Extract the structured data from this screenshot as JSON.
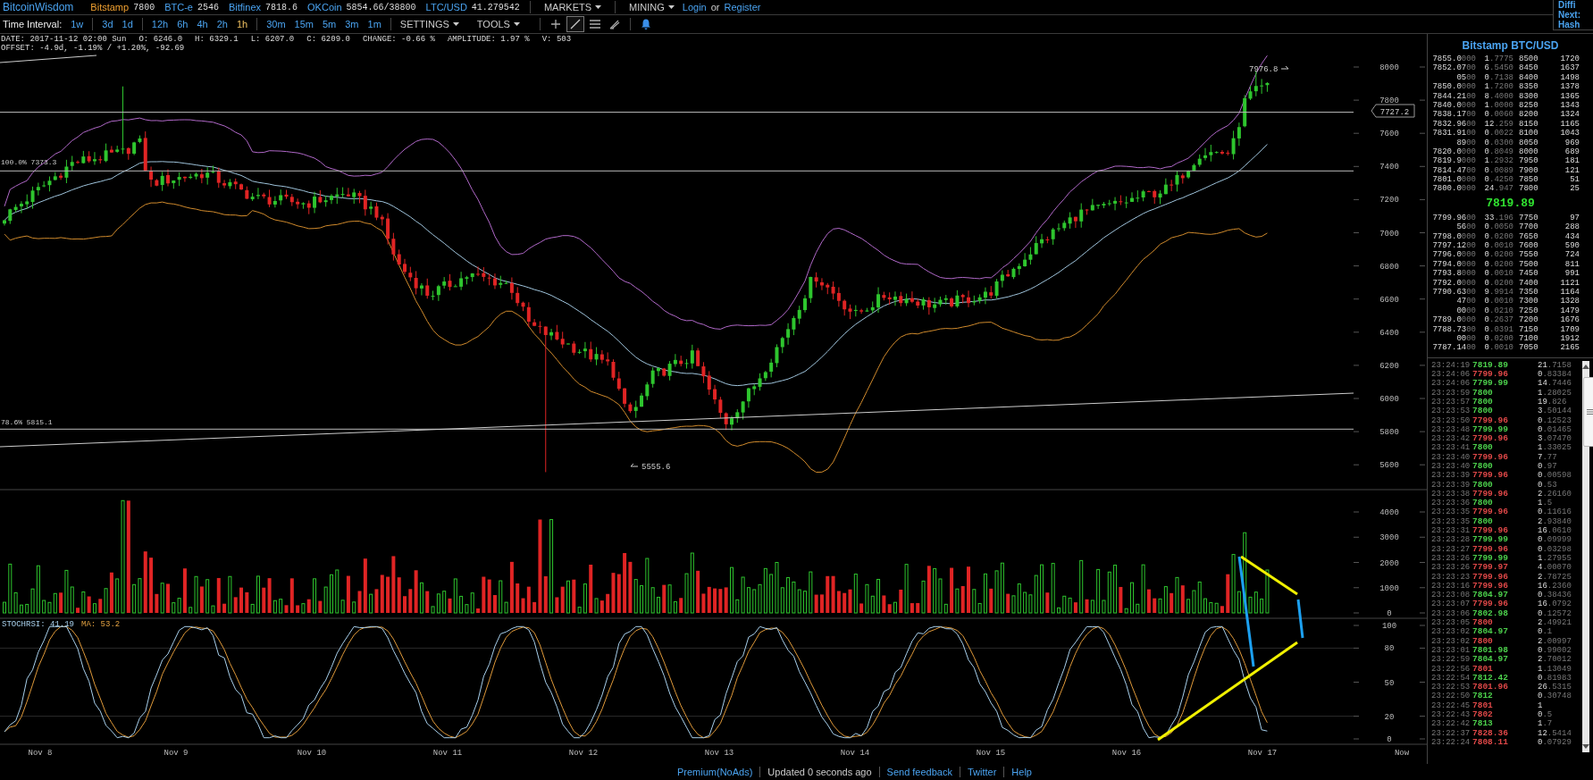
{
  "header": {
    "logo": "BitcoinWisdom",
    "tickers": [
      {
        "exchange": "Bitstamp",
        "price": "7800",
        "selected": true
      },
      {
        "exchange": "BTC-e",
        "price": "2546",
        "selected": false
      },
      {
        "exchange": "Bitfinex",
        "price": "7818.6",
        "selected": false
      },
      {
        "exchange": "OKCoin",
        "price": "5854.66/38800",
        "selected": false
      },
      {
        "exchange": "LTC/USD",
        "price": "41.279542",
        "selected": false
      }
    ],
    "menus": [
      "MARKETS",
      "MINING"
    ],
    "login": "Login",
    "or": "or",
    "register": "Register"
  },
  "mining_box": [
    "Diffi",
    "Next:",
    "Hash"
  ],
  "toolbar": {
    "label": "Time Interval:",
    "interval_groups": [
      [
        {
          "label": "1w",
          "selected": false
        }
      ],
      [
        {
          "label": "3d",
          "selected": false
        },
        {
          "label": "1d",
          "selected": false
        }
      ],
      [
        {
          "label": "12h",
          "selected": false
        },
        {
          "label": "6h",
          "selected": false
        },
        {
          "label": "4h",
          "selected": false
        },
        {
          "label": "2h",
          "selected": false
        },
        {
          "label": "1h",
          "selected": true
        }
      ],
      [
        {
          "label": "30m",
          "selected": false
        },
        {
          "label": "15m",
          "selected": false
        },
        {
          "label": "5m",
          "selected": false
        },
        {
          "label": "3m",
          "selected": false
        },
        {
          "label": "1m",
          "selected": false
        }
      ]
    ],
    "menus": [
      "SETTINGS",
      "TOOLS"
    ],
    "tools": [
      {
        "kind": "plus",
        "selected": false
      },
      {
        "kind": "line",
        "selected": true
      },
      {
        "kind": "lines",
        "selected": false
      },
      {
        "kind": "pen",
        "selected": false
      },
      {
        "kind": "bell",
        "selected": false
      }
    ]
  },
  "info": {
    "line_1": [
      "DATE: 2017-11-12 02:00 Sun",
      "O: 6246.0",
      "H: 6329.1",
      "L: 6207.0",
      "C: 6209.0",
      "CHANGE: -0.66 %",
      "AMPLITUDE: 1.97 %",
      "V: 503"
    ],
    "line_2": "OFFSET: -4.9d, -1.19% / +1.20%, -92.69"
  },
  "chart": {
    "price_ticks": [
      "8000",
      "7800",
      "7600",
      "7400",
      "7200",
      "7000",
      "6800",
      "6600",
      "6400",
      "6200",
      "6000",
      "5800",
      "5600"
    ],
    "current_price_tag": "7727.2",
    "high_label": "7976.8",
    "low_label": "5555.6",
    "fib_labels": [
      "100.0% 7373.3",
      "78.6% 5815.1"
    ],
    "volume_ticks": [
      "4000",
      "3000",
      "2000",
      "1000",
      "0"
    ],
    "stoch_label": "STOCHRSI: 41.19",
    "stoch_ma_label": "MA: 53.2",
    "stoch_ticks": [
      "100",
      "80",
      "50",
      "20",
      "0"
    ],
    "dates": [
      "Nov 8",
      "Nov 9",
      "Nov 10",
      "Nov 11",
      "Nov 12",
      "Nov 13",
      "Nov 14",
      "Nov 15",
      "Nov 16",
      "Nov 17"
    ],
    "now": "Now"
  },
  "order_book": {
    "title": "Bitstamp BTC/USD",
    "asks": [
      {
        "price": "7855.0",
        "price_tail": "000",
        "amount": "1.7775",
        "level": "8500",
        "total": "1720"
      },
      {
        "price": "7852.07",
        "price_tail": "00",
        "amount": "6.5450",
        "level": "8450",
        "total": "1637"
      },
      {
        "price": "05",
        "price_tail": "00",
        "amount": "0.7138",
        "level": "8400",
        "total": "1498"
      },
      {
        "price": "7850.0",
        "price_tail": "000",
        "amount": "1.7200",
        "level": "8350",
        "total": "1378"
      },
      {
        "price": "7844.21",
        "price_tail": "00",
        "amount": "8.4000",
        "level": "8300",
        "total": "1365"
      },
      {
        "price": "7840.0",
        "price_tail": "000",
        "amount": "1.0000",
        "level": "8250",
        "total": "1343"
      },
      {
        "price": "7838.17",
        "price_tail": "00",
        "amount": "0.0060",
        "level": "8200",
        "total": "1324"
      },
      {
        "price": "7832.96",
        "price_tail": "00",
        "amount": "12.259",
        "level": "8150",
        "total": "1165"
      },
      {
        "price": "7831.91",
        "price_tail": "00",
        "amount": "0.0022",
        "level": "8100",
        "total": "1043"
      },
      {
        "price": "89",
        "price_tail": "00",
        "amount": "0.0300",
        "level": "8050",
        "total": "969"
      },
      {
        "price": "7820.0",
        "price_tail": "000",
        "amount": "0.8049",
        "level": "8000",
        "total": "689"
      },
      {
        "price": "7819.9",
        "price_tail": "000",
        "amount": "1.2932",
        "level": "7950",
        "total": "181"
      },
      {
        "price": "7814.47",
        "price_tail": "00",
        "amount": "0.0089",
        "level": "7900",
        "total": "121"
      },
      {
        "price": "7801.0",
        "price_tail": "000",
        "amount": "0.4250",
        "level": "7850",
        "total": "51"
      },
      {
        "price": "7800.0",
        "price_tail": "000",
        "amount": "24.947",
        "level": "7800",
        "total": "25"
      }
    ],
    "last_price": "7819.89",
    "bids": [
      {
        "price": "7799.96",
        "price_tail": "00",
        "amount": "33.196",
        "level": "7750",
        "total": "97"
      },
      {
        "price": "56",
        "price_tail": "00",
        "amount": "0.0050",
        "level": "7700",
        "total": "288"
      },
      {
        "price": "7798.0",
        "price_tail": "000",
        "amount": "0.0200",
        "level": "7650",
        "total": "434"
      },
      {
        "price": "7797.12",
        "price_tail": "00",
        "amount": "0.0010",
        "level": "7600",
        "total": "590"
      },
      {
        "price": "7796.0",
        "price_tail": "000",
        "amount": "0.0200",
        "level": "7550",
        "total": "724"
      },
      {
        "price": "7794.0",
        "price_tail": "000",
        "amount": "0.0200",
        "level": "7500",
        "total": "811"
      },
      {
        "price": "7793.8",
        "price_tail": "000",
        "amount": "0.0010",
        "level": "7450",
        "total": "991"
      },
      {
        "price": "7792.0",
        "price_tail": "000",
        "amount": "0.0200",
        "level": "7400",
        "total": "1121"
      },
      {
        "price": "7790.63",
        "price_tail": "00",
        "amount": "9.9914",
        "level": "7350",
        "total": "1164"
      },
      {
        "price": "47",
        "price_tail": "00",
        "amount": "0.0010",
        "level": "7300",
        "total": "1328"
      },
      {
        "price": "00",
        "price_tail": "00",
        "amount": "0.0210",
        "level": "7250",
        "total": "1479"
      },
      {
        "price": "7789.0",
        "price_tail": "000",
        "amount": "0.2637",
        "level": "7200",
        "total": "1676"
      },
      {
        "price": "7788.73",
        "price_tail": "00",
        "amount": "0.0391",
        "level": "7150",
        "total": "1709"
      },
      {
        "price": "00",
        "price_tail": "00",
        "amount": "0.0200",
        "level": "7100",
        "total": "1912"
      },
      {
        "price": "7787.14",
        "price_tail": "00",
        "amount": "0.0010",
        "level": "7050",
        "total": "2165"
      }
    ]
  },
  "trades": [
    {
      "time": "23:24:19",
      "price": "7819.89",
      "color": "#4cd04c",
      "amount": "21.7158"
    },
    {
      "time": "23:24:06",
      "price": "7799.96",
      "color": "#e04848",
      "amount": "0.83384"
    },
    {
      "time": "23:24:06",
      "price": "7799.99",
      "color": "#4cd04c",
      "amount": "14.7446"
    },
    {
      "time": "23:23:59",
      "price": "7800",
      "color": "#4cd04c",
      "amount": "1.28025"
    },
    {
      "time": "23:23:57",
      "price": "7800",
      "color": "#4cd04c",
      "amount": "19.826"
    },
    {
      "time": "23:23:53",
      "price": "7800",
      "color": "#4cd04c",
      "amount": "3.50144"
    },
    {
      "time": "23:23:50",
      "price": "7799.96",
      "color": "#e04848",
      "amount": "0.12523"
    },
    {
      "time": "23:23:48",
      "price": "7799.99",
      "color": "#4cd04c",
      "amount": "0.01465"
    },
    {
      "time": "23:23:42",
      "price": "7799.96",
      "color": "#e04848",
      "amount": "3.07470"
    },
    {
      "time": "23:23:41",
      "price": "7800",
      "color": "#4cd04c",
      "amount": "1.33025"
    },
    {
      "time": "23:23:40",
      "price": "7799.96",
      "color": "#e04848",
      "amount": "7.77"
    },
    {
      "time": "23:23:40",
      "price": "7800",
      "color": "#4cd04c",
      "amount": "0.97"
    },
    {
      "time": "23:23:39",
      "price": "7799.96",
      "color": "#e04848",
      "amount": "0.00598"
    },
    {
      "time": "23:23:39",
      "price": "7800",
      "color": "#4cd04c",
      "amount": "0.53"
    },
    {
      "time": "23:23:38",
      "price": "7799.96",
      "color": "#e04848",
      "amount": "2.26160"
    },
    {
      "time": "23:23:36",
      "price": "7800",
      "color": "#4cd04c",
      "amount": "1.5"
    },
    {
      "time": "23:23:35",
      "price": "7799.96",
      "color": "#e04848",
      "amount": "0.11616"
    },
    {
      "time": "23:23:35",
      "price": "7800",
      "color": "#4cd04c",
      "amount": "2.93840"
    },
    {
      "time": "23:23:31",
      "price": "7799.96",
      "color": "#e04848",
      "amount": "16.0610"
    },
    {
      "time": "23:23:28",
      "price": "7799.99",
      "color": "#4cd04c",
      "amount": "0.09999"
    },
    {
      "time": "23:23:27",
      "price": "7799.96",
      "color": "#e04848",
      "amount": "0.03298"
    },
    {
      "time": "23:23:26",
      "price": "7799.99",
      "color": "#4cd04c",
      "amount": "1.27955"
    },
    {
      "time": "23:23:26",
      "price": "7799.97",
      "color": "#e04848",
      "amount": "4.00070"
    },
    {
      "time": "23:23:23",
      "price": "7799.96",
      "color": "#e04848",
      "amount": "2.78725"
    },
    {
      "time": "23:23:16",
      "price": "7799.96",
      "color": "#e04848",
      "amount": "16.2360"
    },
    {
      "time": "23:23:08",
      "price": "7804.97",
      "color": "#4cd04c",
      "amount": "0.38436"
    },
    {
      "time": "23:23:07",
      "price": "7799.96",
      "color": "#e04848",
      "amount": "16.0792"
    },
    {
      "time": "23:23:06",
      "price": "7802.98",
      "color": "#4cd04c",
      "amount": "0.12572"
    },
    {
      "time": "23:23:05",
      "price": "7800",
      "color": "#e04848",
      "amount": "2.49921"
    },
    {
      "time": "23:23:02",
      "price": "7804.97",
      "color": "#4cd04c",
      "amount": "0.1"
    },
    {
      "time": "23:23:02",
      "price": "7800",
      "color": "#e04848",
      "amount": "2.00997"
    },
    {
      "time": "23:23:01",
      "price": "7801.98",
      "color": "#4cd04c",
      "amount": "0.99002"
    },
    {
      "time": "23:22:59",
      "price": "7804.97",
      "color": "#4cd04c",
      "amount": "2.70012"
    },
    {
      "time": "23:22:56",
      "price": "7801",
      "color": "#e04848",
      "amount": "1.13049"
    },
    {
      "time": "23:22:54",
      "price": "7812.42",
      "color": "#4cd04c",
      "amount": "0.81983"
    },
    {
      "time": "23:22:53",
      "price": "7801.96",
      "color": "#e04848",
      "amount": "26.5315"
    },
    {
      "time": "23:22:50",
      "price": "7812",
      "color": "#4cd04c",
      "amount": "0.30748"
    },
    {
      "time": "23:22:45",
      "price": "7801",
      "color": "#e04848",
      "amount": "1"
    },
    {
      "time": "23:22:43",
      "price": "7802",
      "color": "#e04848",
      "amount": "0.5"
    },
    {
      "time": "23:22:42",
      "price": "7813",
      "color": "#4cd04c",
      "amount": "1.7"
    },
    {
      "time": "23:22:37",
      "price": "7828.36",
      "color": "#e04848",
      "amount": "12.5414"
    },
    {
      "time": "23:22:24",
      "price": "7808.11",
      "color": "#e04848",
      "amount": "0.07929"
    }
  ],
  "footer": [
    {
      "kind": "link",
      "text": "Premium(NoAds)"
    },
    {
      "kind": "text",
      "text": "Updated 0 seconds ago"
    },
    {
      "kind": "link",
      "text": "Send feedback"
    },
    {
      "kind": "link",
      "text": "Twitter"
    },
    {
      "kind": "link",
      "text": "Help"
    }
  ]
}
